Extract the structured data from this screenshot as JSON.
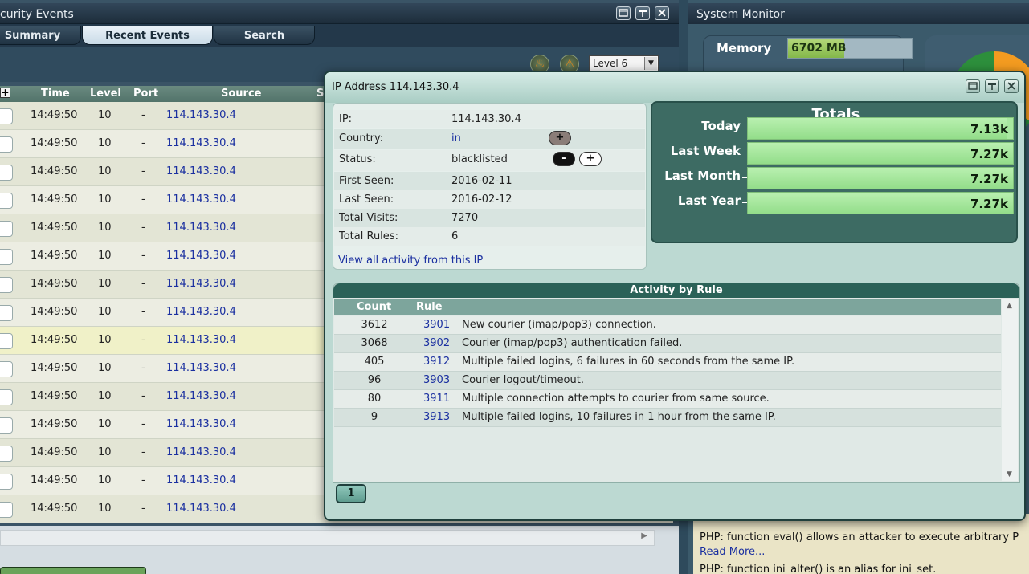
{
  "security_events": {
    "title": "curity Events",
    "tabs": [
      "Summary",
      "Recent Events",
      "Search"
    ],
    "level_select": "Level 6",
    "columns": [
      "Time",
      "Level",
      "Port",
      "Source",
      "S"
    ],
    "expand_all": "+",
    "rows": [
      {
        "time": "14:49:50",
        "level": "10",
        "port": "-",
        "source": "114.143.30.4"
      },
      {
        "time": "14:49:50",
        "level": "10",
        "port": "-",
        "source": "114.143.30.4"
      },
      {
        "time": "14:49:50",
        "level": "10",
        "port": "-",
        "source": "114.143.30.4"
      },
      {
        "time": "14:49:50",
        "level": "10",
        "port": "-",
        "source": "114.143.30.4"
      },
      {
        "time": "14:49:50",
        "level": "10",
        "port": "-",
        "source": "114.143.30.4"
      },
      {
        "time": "14:49:50",
        "level": "10",
        "port": "-",
        "source": "114.143.30.4"
      },
      {
        "time": "14:49:50",
        "level": "10",
        "port": "-",
        "source": "114.143.30.4"
      },
      {
        "time": "14:49:50",
        "level": "10",
        "port": "-",
        "source": "114.143.30.4"
      },
      {
        "time": "14:49:50",
        "level": "10",
        "port": "-",
        "source": "114.143.30.4"
      },
      {
        "time": "14:49:50",
        "level": "10",
        "port": "-",
        "source": "114.143.30.4"
      },
      {
        "time": "14:49:50",
        "level": "10",
        "port": "-",
        "source": "114.143.30.4"
      },
      {
        "time": "14:49:50",
        "level": "10",
        "port": "-",
        "source": "114.143.30.4"
      },
      {
        "time": "14:49:50",
        "level": "10",
        "port": "-",
        "source": "114.143.30.4"
      },
      {
        "time": "14:49:50",
        "level": "10",
        "port": "-",
        "source": "114.143.30.4"
      },
      {
        "time": "14:49:50",
        "level": "10",
        "port": "-",
        "source": "114.143.30.4"
      }
    ]
  },
  "system_monitor": {
    "title": "System Monitor",
    "memory_label": "Memory",
    "memory_value": "6702 MB",
    "news": [
      {
        "text": "PHP: function eval() allows an attacker to execute arbitrary P",
        "link": "Read More..."
      },
      {
        "text": "PHP: function ini_alter() is an alias for ini_set.",
        "link": ""
      }
    ],
    "partial_link": "Read More..."
  },
  "ip_dialog": {
    "title": "IP Address 114.143.30.4",
    "info": {
      "ip_label": "IP:",
      "ip": "114.143.30.4",
      "country_label": "Country:",
      "country": "in",
      "status_label": "Status:",
      "status": "blacklisted",
      "first_seen_label": "First Seen:",
      "first_seen": "2016-02-11",
      "last_seen_label": "Last Seen:",
      "last_seen": "2016-02-12",
      "total_visits_label": "Total Visits:",
      "total_visits": "7270",
      "total_rules_label": "Total Rules:",
      "total_rules": "6",
      "view_all": "View all activity from this IP",
      "plus": "+",
      "minus": "-"
    },
    "totals": {
      "title": "Totals",
      "rows": [
        {
          "label": "Today",
          "value": "7.13k",
          "fill": 0.98
        },
        {
          "label": "Last Week",
          "value": "7.27k",
          "fill": 1.0
        },
        {
          "label": "Last Month",
          "value": "7.27k",
          "fill": 1.0
        },
        {
          "label": "Last Year",
          "value": "7.27k",
          "fill": 1.0
        }
      ]
    },
    "activity": {
      "title": "Activity by Rule",
      "columns": [
        "Count",
        "Rule"
      ],
      "rows": [
        {
          "count": "3612",
          "rule": "3901",
          "desc": "New courier (imap/pop3) connection."
        },
        {
          "count": "3068",
          "rule": "3902",
          "desc": "Courier (imap/pop3) authentication failed."
        },
        {
          "count": "405",
          "rule": "3912",
          "desc": "Multiple failed logins, 6 failures in 60 seconds from the same IP."
        },
        {
          "count": "96",
          "rule": "3903",
          "desc": "Courier logout/timeout."
        },
        {
          "count": "80",
          "rule": "3911",
          "desc": "Multiple connection attempts to courier from same source."
        },
        {
          "count": "9",
          "rule": "3913",
          "desc": "Multiple failed logins, 10 failures in 1 hour from the same IP."
        }
      ]
    },
    "page": "1"
  }
}
